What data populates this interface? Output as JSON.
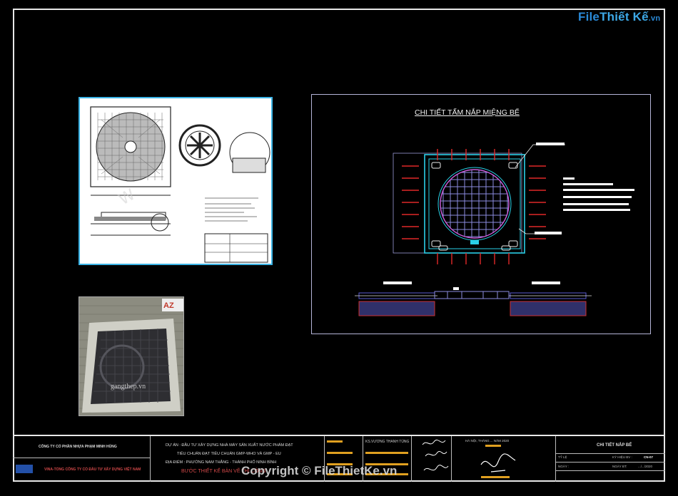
{
  "logo": {
    "part1": "File",
    "part2": "Thiết Kế",
    "part3": ".vn"
  },
  "photo": {
    "watermark": "gangthep.vn",
    "brand": "AZ"
  },
  "detail": {
    "title": "CHI TIẾT TẤM NẮP MIỆNG BỂ"
  },
  "titleblock": {
    "company": "CÔNG TY CỔ PHẦN NHỰA PHẠM MINH HÙNG",
    "subcompany": "VINA-TỔNG CÔNG TY CỔ ĐẦU TƯ XÂY DỰNG VIỆT NAM",
    "project_line1": "DỰ ÁN : ĐẦU TƯ XÂY DỰNG NHÀ MÁY SẢN XUẤT NƯỚC PHẨM ĐẠT",
    "project_line2": "TIÊU CHUẨN ĐẠT TIÊU CHUẨN GMP-WHO VÀ GMP - EU",
    "project_line3": "ĐỊA ĐIỂM : PHƯỜNG NAM THẮNG - THÀNH PHỐ NINH BÌNH",
    "stage": "BƯỚC THIẾT KẾ BẢN VẼ THI CÔNG",
    "person": "KS.VƯƠNG THANH TÙNG",
    "place_date": "HÀ NỘI, THÁNG ... NĂM 2020",
    "drawing_title": "CHI TIẾT NẮP BỂ",
    "field_ratio": "TỶ LỆ",
    "field_code": "KÝ HIỆU BV :",
    "code_value": "CN-07",
    "field_date": "NGÀY :",
    "date_value": ".../.../2020",
    "field_sheet": "NGÀY BT:"
  },
  "copyright": "Copyright © FileThietKe.vn"
}
